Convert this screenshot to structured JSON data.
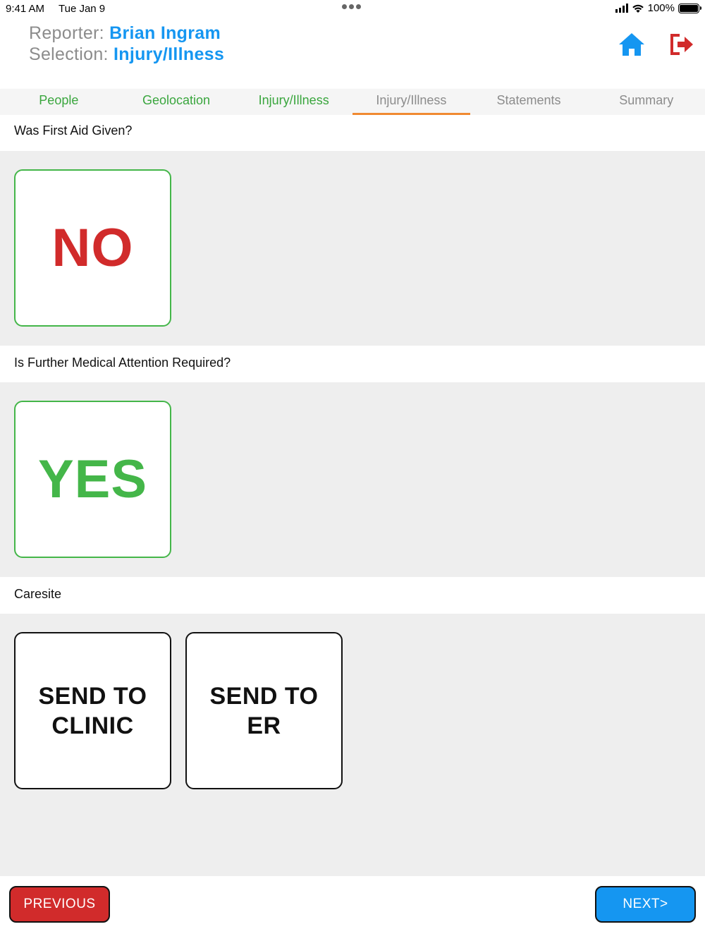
{
  "status_bar": {
    "time": "9:41 AM",
    "date": "Tue Jan 9",
    "battery": "100%",
    "battery_level": 1.0
  },
  "header": {
    "reporter_label": "Reporter:",
    "reporter_name": "Brian Ingram",
    "selection_label": "Selection:",
    "selection_value": "Injury/Illness",
    "home_icon": "home-icon",
    "exit_icon": "sign-out-icon",
    "colors": {
      "accent": "#1596f1",
      "exit": "#d12b2b",
      "header_bg": "#dcdcdc"
    }
  },
  "tabs": [
    {
      "label": "People",
      "state": "done"
    },
    {
      "label": "Geolocation",
      "state": "done"
    },
    {
      "label": "Injury/Illness",
      "state": "done"
    },
    {
      "label": "Injury/Illness",
      "state": "active"
    },
    {
      "label": "Statements",
      "state": "pending"
    },
    {
      "label": "Summary",
      "state": "pending"
    }
  ],
  "sections": {
    "first_aid": {
      "question": "Was First Aid Given?",
      "answer": "NO"
    },
    "medical_attention": {
      "question": "Is Further Medical Attention Required?",
      "answer": "YES"
    },
    "caresite": {
      "question": "Caresite",
      "options": [
        {
          "line1": "SEND TO",
          "line2": "CLINIC"
        },
        {
          "line1": "SEND TO",
          "line2": "ER"
        }
      ]
    }
  },
  "footer": {
    "previous_label": "PREVIOUS",
    "next_label": "NEXT>"
  }
}
